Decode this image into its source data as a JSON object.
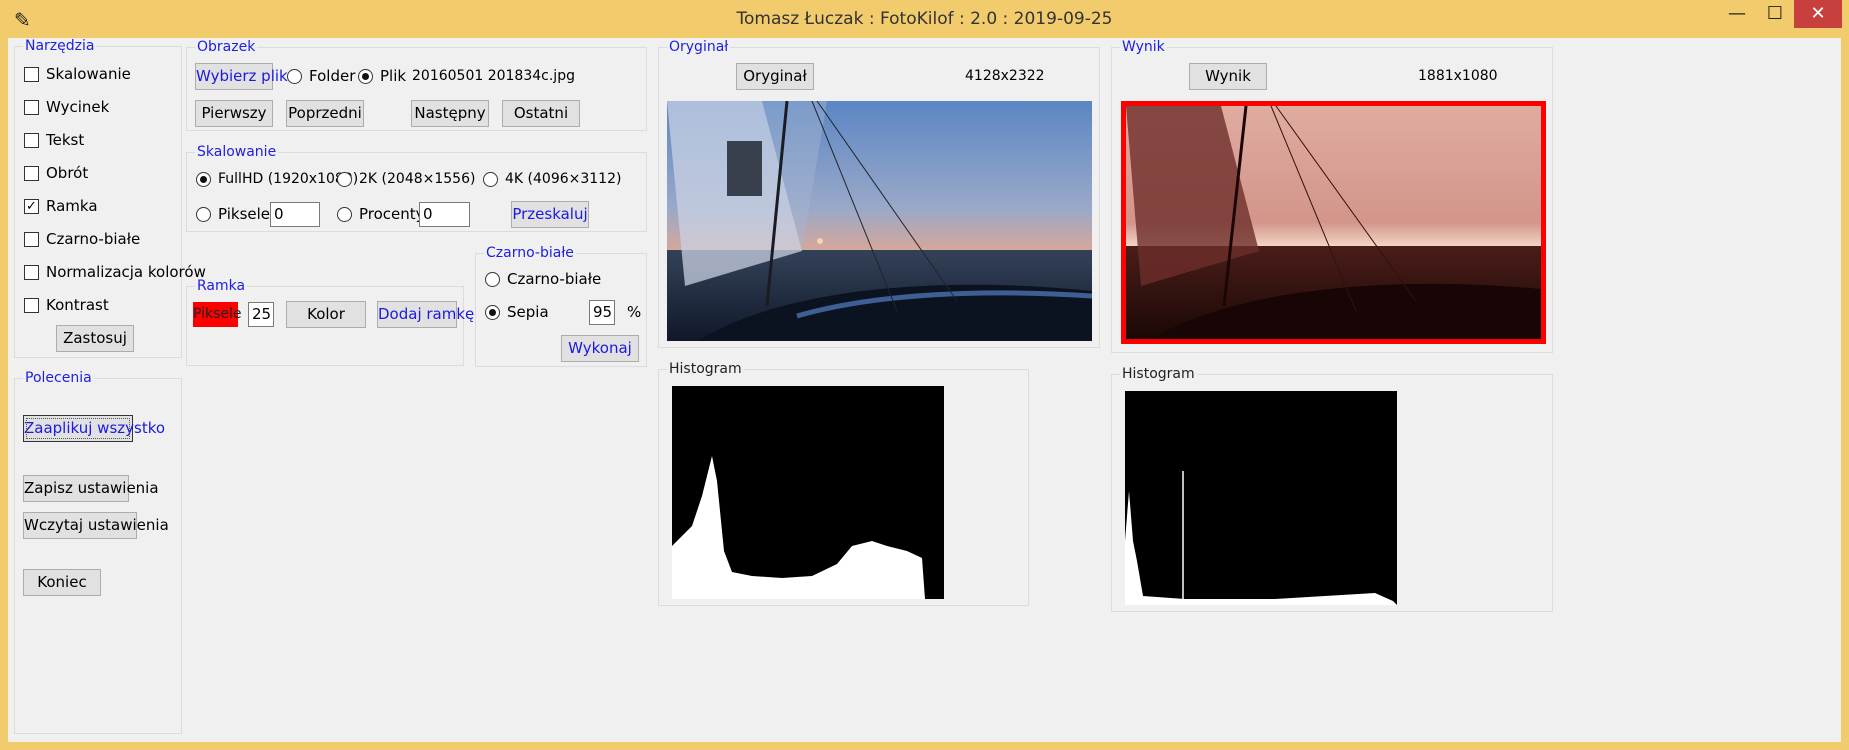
{
  "window": {
    "title": "Tomasz Łuczak : FotoKilof : 2.0 : 2019-09-25",
    "app_icon": "feather-icon",
    "minimize": "—",
    "maximize": "☐",
    "close": "✕"
  },
  "tools": {
    "title": "Narzędzia",
    "items": [
      {
        "label": "Skalowanie",
        "checked": false
      },
      {
        "label": "Wycinek",
        "checked": false
      },
      {
        "label": "Tekst",
        "checked": false
      },
      {
        "label": "Obrót",
        "checked": false
      },
      {
        "label": "Ramka",
        "checked": true
      },
      {
        "label": "Czarno-białe",
        "checked": false
      },
      {
        "label": "Normalizacja kolorów",
        "checked": false
      },
      {
        "label": "Kontrast",
        "checked": false
      }
    ],
    "apply": "Zastosuj"
  },
  "commands": {
    "title": "Polecenia",
    "apply_all": "Zaaplikuj wszystko",
    "save": "Zapisz ustawienia",
    "load": "Wczytaj ustawienia",
    "quit": "Koniec"
  },
  "image": {
    "title": "Obrazek",
    "choose": "Wybierz plik",
    "folder": "Folder",
    "file": "Plik",
    "filename": "20160501 201834c.jpg",
    "first": "Pierwszy",
    "prev": "Poprzedni",
    "next": "Następny",
    "last": "Ostatni"
  },
  "scaling": {
    "title": "Skalowanie",
    "fullhd": "FullHD (1920x1080)",
    "twok": "2K (2048×1556)",
    "fourk": "4K (4096×3112)",
    "pixels": "Piksele",
    "pixels_value": "0",
    "percent": "Procenty",
    "percent_value": "0",
    "rescale": "Przeskaluj"
  },
  "frame": {
    "title": "Ramka",
    "pixels_label": "Piksele",
    "pixels_value": "25",
    "color": "Kolor",
    "add": "Dodaj ramkę"
  },
  "bw": {
    "title": "Czarno-białe",
    "bw_option": "Czarno-białe",
    "sepia": "Sepia",
    "sepia_value": "95",
    "percent_sign": "%",
    "run": "Wykonaj"
  },
  "original": {
    "title": "Oryginał",
    "button": "Oryginał",
    "size": "4128x2322",
    "histogram_title": "Histogram"
  },
  "result": {
    "title": "Wynik",
    "button": "Wynik",
    "size": "1881x1080",
    "histogram_title": "Histogram",
    "frame_color": "#ff0000"
  }
}
